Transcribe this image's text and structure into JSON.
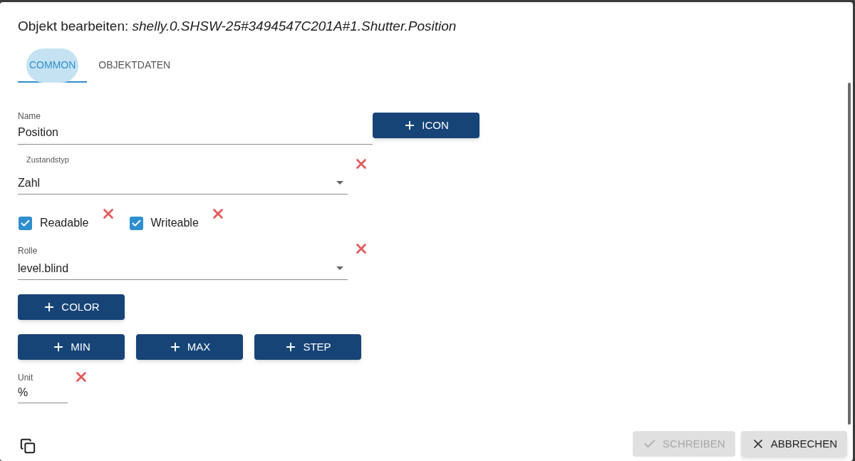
{
  "dialog": {
    "title_prefix": "Objekt bearbeiten:",
    "title_object": "shelly.0.SHSW-25#3494547C201A#1.Shutter.Position"
  },
  "tabs": [
    {
      "label": "COMMON",
      "selected": true
    },
    {
      "label": "OBJEKTDATEN",
      "selected": false
    }
  ],
  "form": {
    "name": {
      "label": "Name",
      "value": "Position"
    },
    "icon_button": "ICON",
    "state_type": {
      "label": "Zustandstyp",
      "value": "Zahl"
    },
    "checkboxes": [
      {
        "label": "Readable",
        "checked": true
      },
      {
        "label": "Writeable",
        "checked": true
      }
    ],
    "role": {
      "label": "Rolle",
      "value": "level.blind"
    },
    "color_button": "COLOR",
    "range_buttons": [
      "MIN",
      "MAX",
      "STEP"
    ],
    "unit": {
      "label": "Unit",
      "value": "%"
    }
  },
  "footer": {
    "buttons": [
      {
        "kind": "check",
        "label": "SCHREIBEN",
        "disabled": true
      },
      {
        "kind": "close",
        "label": "ABBRECHEN",
        "disabled": false
      }
    ]
  }
}
